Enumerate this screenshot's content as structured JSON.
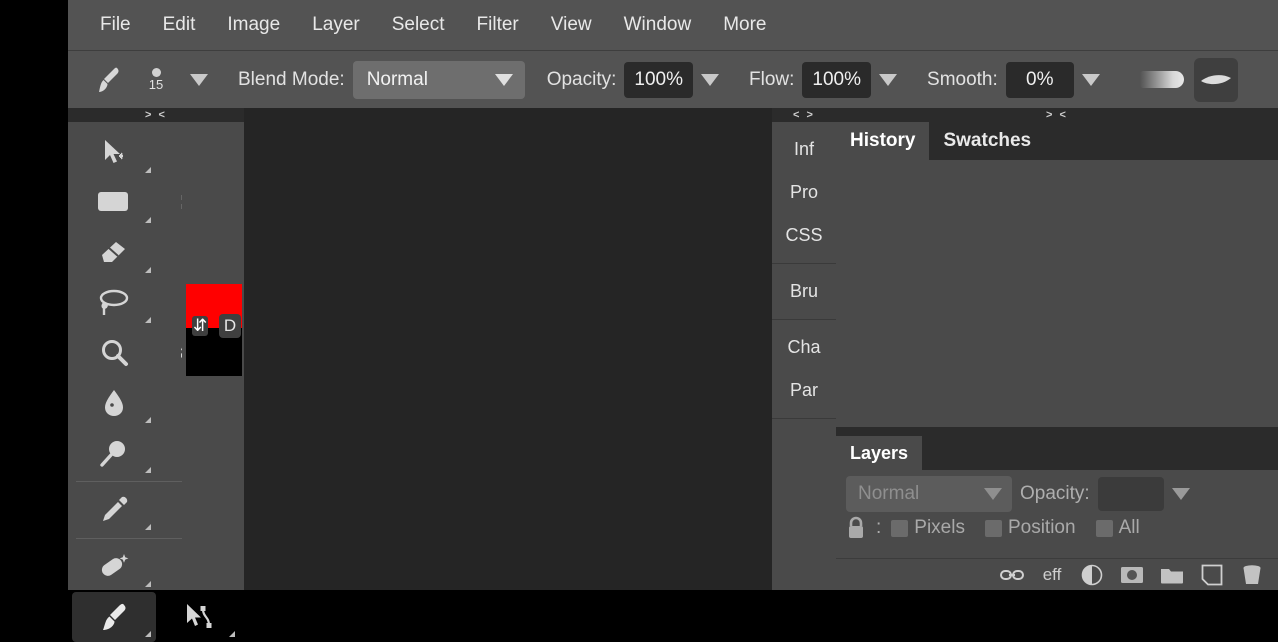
{
  "menubar": {
    "items": [
      {
        "label": "File"
      },
      {
        "label": "Edit"
      },
      {
        "label": "Image"
      },
      {
        "label": "Layer"
      },
      {
        "label": "Select"
      },
      {
        "label": "Filter"
      },
      {
        "label": "View"
      },
      {
        "label": "Window"
      },
      {
        "label": "More"
      }
    ]
  },
  "optionsbar": {
    "brush_icon": "brush-icon",
    "brush_size": "15",
    "blend_mode_label": "Blend Mode:",
    "blend_mode_value": "Normal",
    "opacity_label": "Opacity:",
    "opacity_value": "100%",
    "flow_label": "Flow:",
    "flow_value": "100%",
    "smooth_label": "Smooth:",
    "smooth_value": "0%",
    "airbrush_icon": "soft-stroke-preview-icon",
    "pressure_icon": "tapered-stroke-icon"
  },
  "toolbox": {
    "handle": "> <",
    "tools": [
      {
        "name": "move-tool",
        "icon": "move-arrow-icon",
        "active": false
      },
      {
        "name": "clone-stamp-tool",
        "icon": "stamp-icon",
        "active": false
      },
      {
        "name": "shape-tool",
        "icon": "rounded-rectangle-icon",
        "active": false
      },
      {
        "name": "marquee-tool",
        "icon": "dashed-rectangle-icon",
        "active": false
      },
      {
        "name": "eraser-tool",
        "icon": "eraser-icon",
        "active": false
      },
      {
        "name": "hand-tool",
        "icon": "hand-icon",
        "active": false
      },
      {
        "name": "lasso-tool",
        "icon": "lasso-icon",
        "active": false
      },
      {
        "name": "gradient-tool",
        "icon": "gradient-icon",
        "active": false
      },
      {
        "name": "zoom-tool",
        "icon": "magnifier-icon",
        "active": false
      },
      {
        "name": "quick-select-tool",
        "icon": "quick-selection-brush-icon",
        "active": false
      },
      {
        "name": "blur-tool",
        "icon": "water-drop-icon",
        "active": false
      },
      {
        "name": "crop-tool",
        "icon": "crop-icon",
        "active": false
      },
      {
        "name": "dodge-tool",
        "icon": "dodge-lollipop-icon",
        "active": false
      },
      {
        "name": "eyedropper-tool",
        "icon": "eyedropper-icon",
        "active": false
      },
      {
        "name": "type-tool",
        "icon": "text-t-icon",
        "active": false
      },
      {
        "name": "healing-brush-tool",
        "icon": "healing-patch-icon",
        "active": false
      },
      {
        "name": "pen-tool",
        "icon": "pen-nib-icon",
        "active": false
      },
      {
        "name": "brush-tool",
        "icon": "paintbrush-icon",
        "active": true
      },
      {
        "name": "path-selection-tool",
        "icon": "path-arrow-icon",
        "active": false
      }
    ],
    "colors": {
      "foreground": "#ff0000",
      "background": "#000000",
      "swap_icon": "swap-colors-arrows-icon",
      "default_label": "D"
    }
  },
  "mini_dock": {
    "handle": "< >",
    "groups": [
      {
        "tabs": [
          {
            "label": "Inf"
          },
          {
            "label": "Pro"
          },
          {
            "label": "CSS"
          }
        ]
      },
      {
        "tabs": [
          {
            "label": "Bru"
          }
        ]
      },
      {
        "tabs": [
          {
            "label": "Cha"
          },
          {
            "label": "Par"
          }
        ]
      }
    ]
  },
  "right_dock": {
    "handle": "> <",
    "tabs": [
      {
        "label": "History",
        "active": true
      },
      {
        "label": "Swatches",
        "active": false
      }
    ],
    "layers": {
      "tabs": [
        {
          "label": "Layers",
          "active": true
        }
      ],
      "blend_mode_value": "Normal",
      "opacity_label": "Opacity:",
      "opacity_value": "",
      "lock_icon": "padlock-icon",
      "lock_colon": ":",
      "lock_options": [
        {
          "label": "Pixels"
        },
        {
          "label": "Position"
        },
        {
          "label": "All"
        }
      ],
      "bottom_icons": [
        {
          "name": "link-layers-icon",
          "label": ""
        },
        {
          "name": "layer-effects-icon",
          "label": "eff"
        },
        {
          "name": "adjustment-layer-icon",
          "label": ""
        },
        {
          "name": "layer-mask-icon",
          "label": ""
        },
        {
          "name": "new-group-icon",
          "label": ""
        },
        {
          "name": "new-layer-icon",
          "label": ""
        },
        {
          "name": "delete-layer-icon",
          "label": ""
        }
      ]
    }
  },
  "colors": {
    "chrome": "#535353",
    "panel": "#4a4a4a",
    "canvas": "#252525",
    "dark": "#2b2b2b",
    "accent_red": "#ff0000"
  }
}
